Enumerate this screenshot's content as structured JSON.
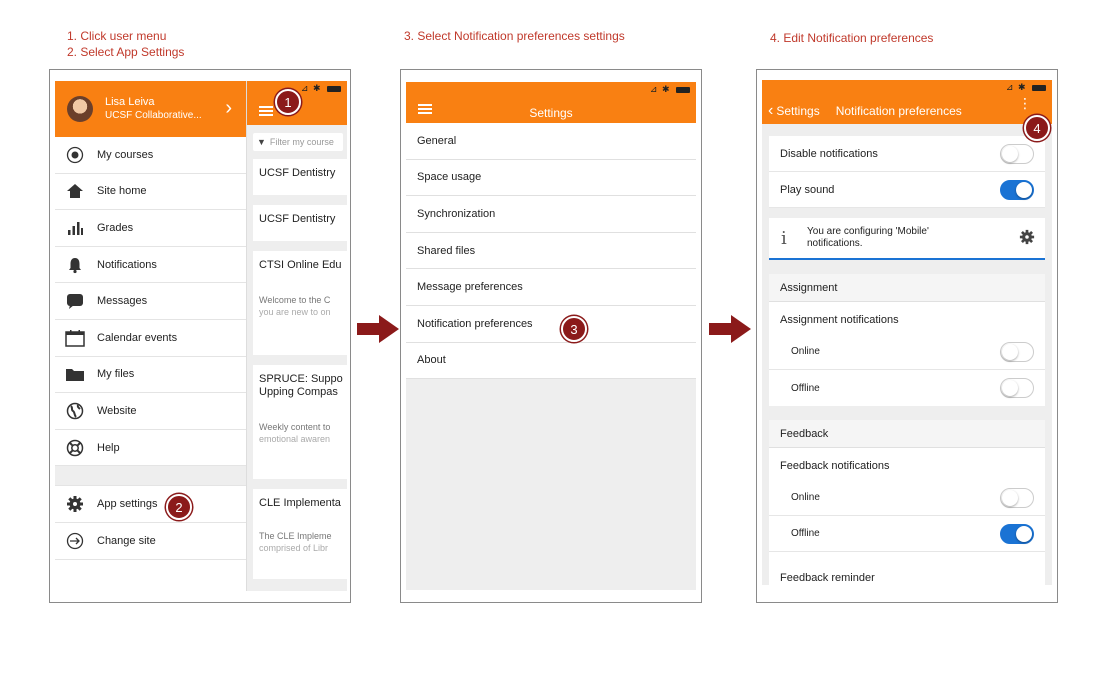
{
  "steps": {
    "s1": "1.  Click user menu",
    "s2": "2.  Select App Settings",
    "s3": "3.  Select Notification preferences settings",
    "s4": "4.  Edit Notification preferences"
  },
  "badges": [
    "1",
    "2",
    "3",
    "4"
  ],
  "colors": {
    "brand_orange": "#f98012",
    "toggle_blue": "#1a73d4",
    "step_red": "#c0392b",
    "badge_red": "#8b1a1a"
  },
  "panel1": {
    "user": {
      "name": "Lisa Leiva",
      "subtitle": "UCSF Collaborative..."
    },
    "menu": [
      {
        "label": "My courses",
        "icon": "target-icon"
      },
      {
        "label": "Site home",
        "icon": "home-icon"
      },
      {
        "label": "Grades",
        "icon": "bar-chart-icon"
      },
      {
        "label": "Notifications",
        "icon": "bell-icon"
      },
      {
        "label": "Messages",
        "icon": "chat-bubble-icon"
      },
      {
        "label": "Calendar events",
        "icon": "calendar-icon"
      },
      {
        "label": "My files",
        "icon": "folder-icon"
      },
      {
        "label": "Website",
        "icon": "globe-icon"
      },
      {
        "label": "Help",
        "icon": "lifebuoy-icon"
      }
    ],
    "footer_menu": [
      {
        "label": "App settings",
        "icon": "gear-icon"
      },
      {
        "label": "Change site",
        "icon": "exit-icon"
      }
    ],
    "behind": {
      "filter_placeholder": "Filter my course",
      "cards": [
        {
          "title": "UCSF Dentistry",
          "body": "",
          "body2": ""
        },
        {
          "title": "UCSF Dentistry",
          "body": "",
          "body2": ""
        },
        {
          "title": "CTSI Online Edu",
          "body": "Welcome to the C",
          "body2": "you are new to on"
        },
        {
          "title": "SPRUCE: Suppo",
          "title2": "Upping Compas",
          "body": "Weekly content to",
          "body2": "emotional awaren"
        },
        {
          "title": "CLE Implementa",
          "body": "The CLE Impleme",
          "body2": "comprised of Libr"
        }
      ]
    }
  },
  "panel2": {
    "title": "Settings",
    "items": [
      "General",
      "Space usage",
      "Synchronization",
      "Shared files",
      "Message preferences",
      "Notification preferences",
      "About"
    ]
  },
  "panel3": {
    "back_label": "Settings",
    "title": "Notification preferences",
    "disable_label": "Disable notifications",
    "disable_on": false,
    "sound_label": "Play sound",
    "sound_on": true,
    "info_line1": "You are configuring 'Mobile'",
    "info_line2": "notifications.",
    "assignment": {
      "heading": "Assignment",
      "label": "Assignment notifications",
      "online": "Online",
      "online_on": false,
      "offline": "Offline",
      "offline_on": false
    },
    "feedback": {
      "heading": "Feedback",
      "label": "Feedback notifications",
      "online": "Online",
      "online_on": false,
      "offline": "Offline",
      "offline_on": true,
      "reminder": "Feedback reminder"
    }
  }
}
